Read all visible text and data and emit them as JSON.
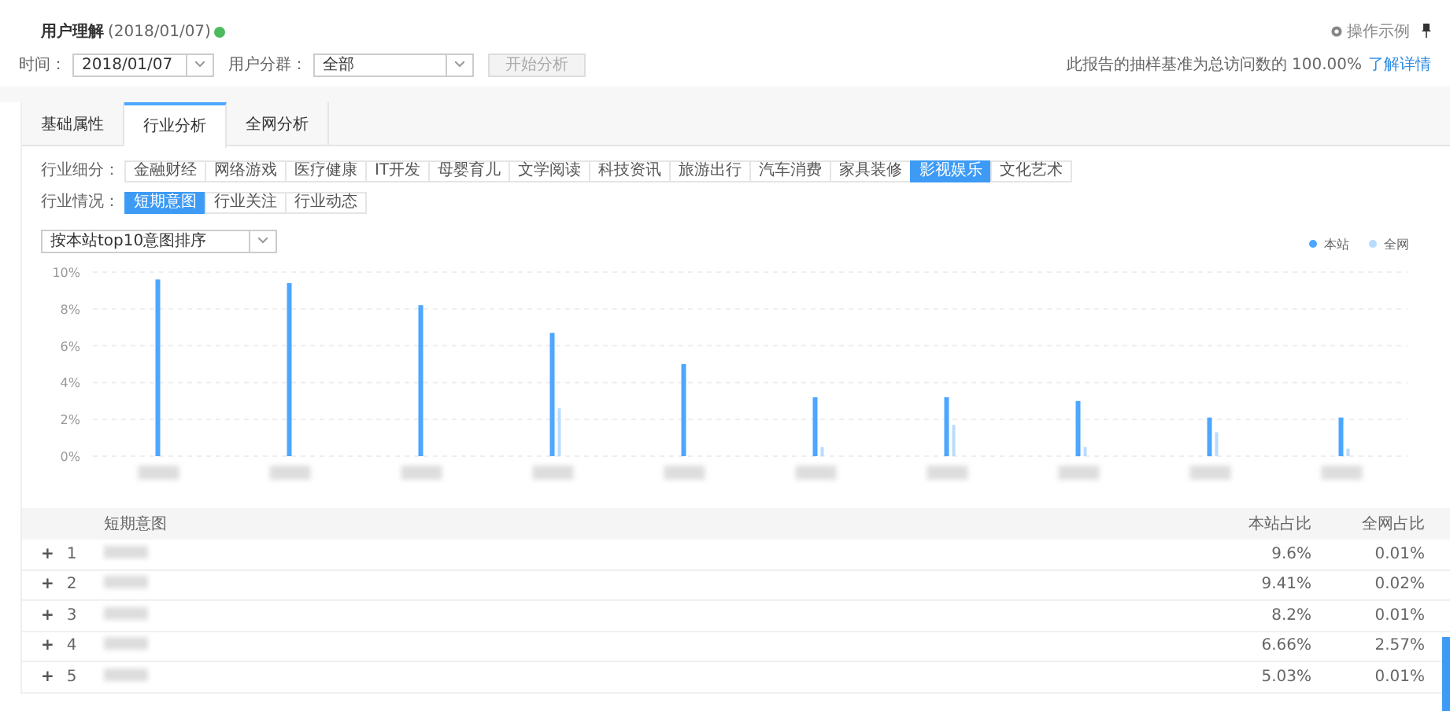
{
  "header": {
    "title": "用户理解",
    "date": "(2018/01/07)",
    "help_link": "操作示例"
  },
  "filters": {
    "time_label": "时间：",
    "time_value": "2018/01/07",
    "segment_label": "用户分群：",
    "segment_value": "全部",
    "start_button": "开始分析",
    "sampling_note": "此报告的抽样基准为总访问数的 100.00%",
    "details_link": "了解详情"
  },
  "tabs": [
    {
      "label": "基础属性",
      "selected": false
    },
    {
      "label": "行业分析",
      "selected": true
    },
    {
      "label": "全网分析",
      "selected": false
    }
  ],
  "industry_label": "行业细分：",
  "industries": [
    {
      "label": "金融财经",
      "selected": false
    },
    {
      "label": "网络游戏",
      "selected": false
    },
    {
      "label": "医疗健康",
      "selected": false
    },
    {
      "label": "IT开发",
      "selected": false
    },
    {
      "label": "母婴育儿",
      "selected": false
    },
    {
      "label": "文学阅读",
      "selected": false
    },
    {
      "label": "科技资讯",
      "selected": false
    },
    {
      "label": "旅游出行",
      "selected": false
    },
    {
      "label": "汽车消费",
      "selected": false
    },
    {
      "label": "家具装修",
      "selected": false
    },
    {
      "label": "影视娱乐",
      "selected": true
    },
    {
      "label": "文化艺术",
      "selected": false
    }
  ],
  "situation_label": "行业情况：",
  "situations": [
    {
      "label": "短期意图",
      "selected": true
    },
    {
      "label": "行业关注",
      "selected": false
    },
    {
      "label": "行业动态",
      "selected": false
    }
  ],
  "sort_select": "按本站top10意图排序",
  "chart": {
    "chart_data": {
      "type": "bar",
      "grid": true,
      "legend": true,
      "ylim": [
        0,
        10
      ],
      "yticks": [
        {
          "value": 0,
          "label": "0%"
        },
        {
          "value": 2,
          "label": "2%"
        },
        {
          "value": 4,
          "label": "4%"
        },
        {
          "value": 6,
          "label": "6%"
        },
        {
          "value": 8,
          "label": "8%"
        },
        {
          "value": 10,
          "label": "10%"
        }
      ],
      "series": [
        {
          "name": "本站",
          "color": "#4da6ff",
          "values": [
            9.6,
            9.4,
            8.2,
            6.7,
            5.0,
            3.2,
            3.2,
            3.0,
            2.1,
            2.1
          ]
        },
        {
          "name": "全网",
          "color": "#b8dcff",
          "values": [
            0,
            0,
            0,
            2.6,
            0,
            0.5,
            1.7,
            0.5,
            1.3,
            0.4
          ]
        }
      ]
    }
  },
  "table": {
    "columns": [
      "短期意图",
      "本站占比",
      "全网占比"
    ],
    "rows": [
      {
        "expand": "+",
        "rank": "1",
        "site_share": "9.6%",
        "web_share": "0.01%"
      },
      {
        "expand": "+",
        "rank": "2",
        "site_share": "9.41%",
        "web_share": "0.02%"
      },
      {
        "expand": "+",
        "rank": "3",
        "site_share": "8.2%",
        "web_share": "0.01%"
      },
      {
        "expand": "+",
        "rank": "4",
        "site_share": "6.66%",
        "web_share": "2.57%"
      },
      {
        "expand": "+",
        "rank": "5",
        "site_share": "5.03%",
        "web_share": "0.01%"
      }
    ]
  }
}
